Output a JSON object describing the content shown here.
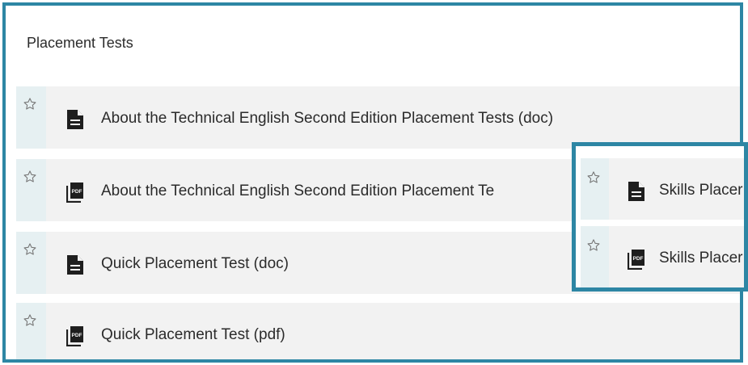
{
  "section": {
    "title": "Placement Tests"
  },
  "rows": [
    {
      "label": "About the Technical English Second Edition Placement Tests (doc)",
      "icon": "doc-icon"
    },
    {
      "label": "About the Technical English Second Edition Placement Te",
      "icon": "pdf-icon"
    },
    {
      "label": "Quick Placement Test (doc)",
      "icon": "doc-icon"
    },
    {
      "label": "Quick Placement Test (pdf)",
      "icon": "pdf-icon"
    }
  ],
  "popup": {
    "rows": [
      {
        "label": "Skills Placer",
        "icon": "doc-icon"
      },
      {
        "label": "Skills Placer",
        "icon": "pdf-icon"
      }
    ]
  },
  "colors": {
    "frame_border": "#2d86a4",
    "row_bg": "#f2f2f2",
    "star_cell_bg": "#e6f0f2"
  }
}
